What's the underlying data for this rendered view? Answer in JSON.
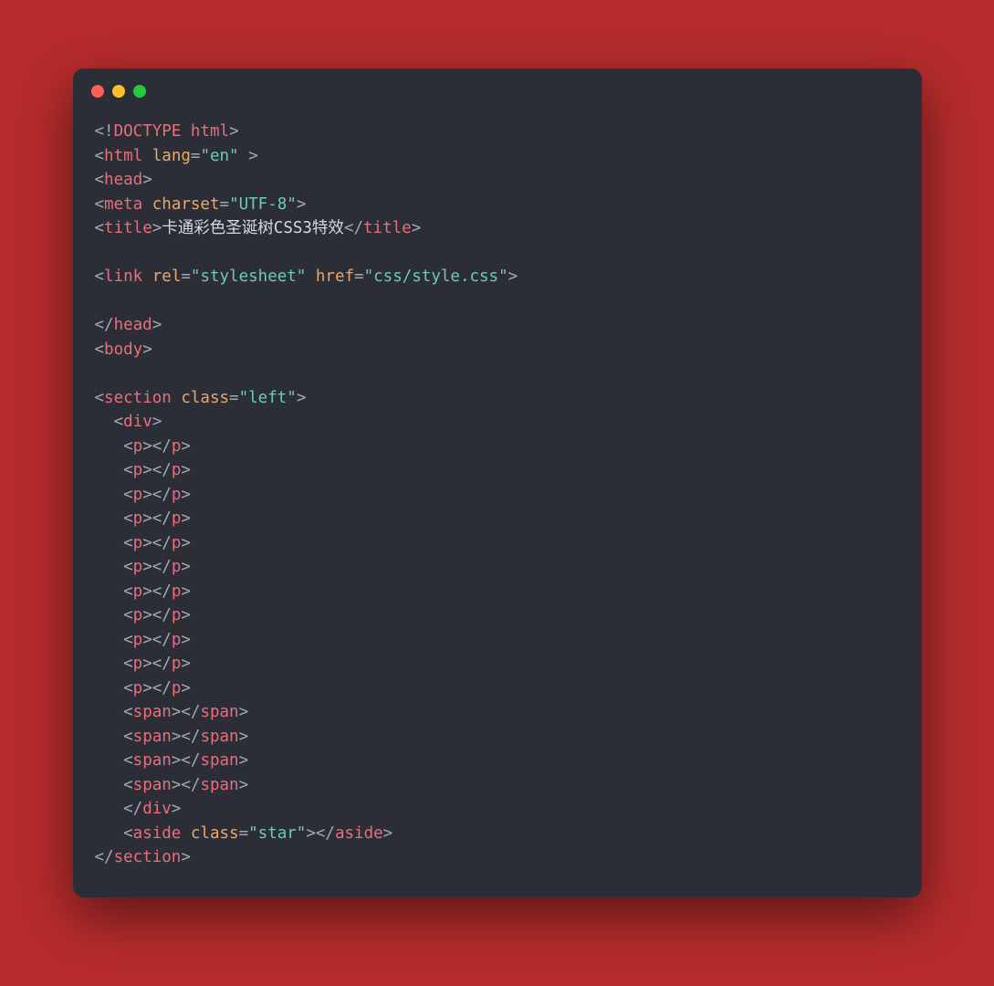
{
  "colors": {
    "background": "#b72c2c",
    "window": "#2b2e36",
    "punct": "#a3a8b1",
    "tag": "#e86f7c",
    "attr": "#e6a96b",
    "string": "#6fc9bb",
    "text": "#d6d9de"
  },
  "window": {
    "close": "close",
    "minimize": "minimize",
    "maximize": "maximize"
  },
  "code": {
    "line1": {
      "lt": "<",
      "bang": "!",
      "doctype": "DOCTYPE",
      "sp": " ",
      "html": "html",
      "gt": ">"
    },
    "line2": {
      "lt": "<",
      "tag": "html",
      "sp": " ",
      "attr": "lang",
      "eq": "=",
      "val": "\"en\"",
      "sp2": " ",
      "gt": ">"
    },
    "line3": {
      "lt": "<",
      "tag": "head",
      "gt": ">"
    },
    "line4": {
      "lt": "<",
      "tag": "meta",
      "sp": " ",
      "attr": "charset",
      "eq": "=",
      "val": "\"UTF-8\"",
      "gt": ">"
    },
    "line5": {
      "lt": "<",
      "tag": "title",
      "gt": ">",
      "text": "卡通彩色圣诞树CSS3特效",
      "lt2": "</",
      "tag2": "title",
      "gt2": ">"
    },
    "line6": {
      "lt": "<",
      "tag": "link",
      "sp": " ",
      "attr1": "rel",
      "eq1": "=",
      "val1": "\"stylesheet\"",
      "sp2": " ",
      "attr2": "href",
      "eq2": "=",
      "val2": "\"css/style.css\"",
      "gt": ">"
    },
    "line7": {
      "lt": "</",
      "tag": "head",
      "gt": ">"
    },
    "line8": {
      "lt": "<",
      "tag": "body",
      "gt": ">"
    },
    "line9": {
      "lt": "<",
      "tag": "section",
      "sp": " ",
      "attr": "class",
      "eq": "=",
      "val": "\"left\"",
      "gt": ">"
    },
    "line10": {
      "indent": "  ",
      "lt": "<",
      "tag": "div",
      "gt": ">"
    },
    "pline": {
      "indent": "   ",
      "lt": "<",
      "tag": "p",
      "gt": ">",
      "lt2": "</",
      "tag2": "p",
      "gt2": ">"
    },
    "spanline": {
      "indent": "   ",
      "lt": "<",
      "tag": "span",
      "gt": ">",
      "lt2": "</",
      "tag2": "span",
      "gt2": ">"
    },
    "line22": {
      "indent": "   ",
      "lt": "</",
      "tag": "div",
      "gt": ">"
    },
    "line23": {
      "indent": "   ",
      "lt": "<",
      "tag": "aside",
      "sp": " ",
      "attr": "class",
      "eq": "=",
      "val": "\"star\"",
      "gt": ">",
      "lt2": "</",
      "tag2": "aside",
      "gt2": ">"
    },
    "line24": {
      "lt": "</",
      "tag": "section",
      "gt": ">"
    }
  }
}
